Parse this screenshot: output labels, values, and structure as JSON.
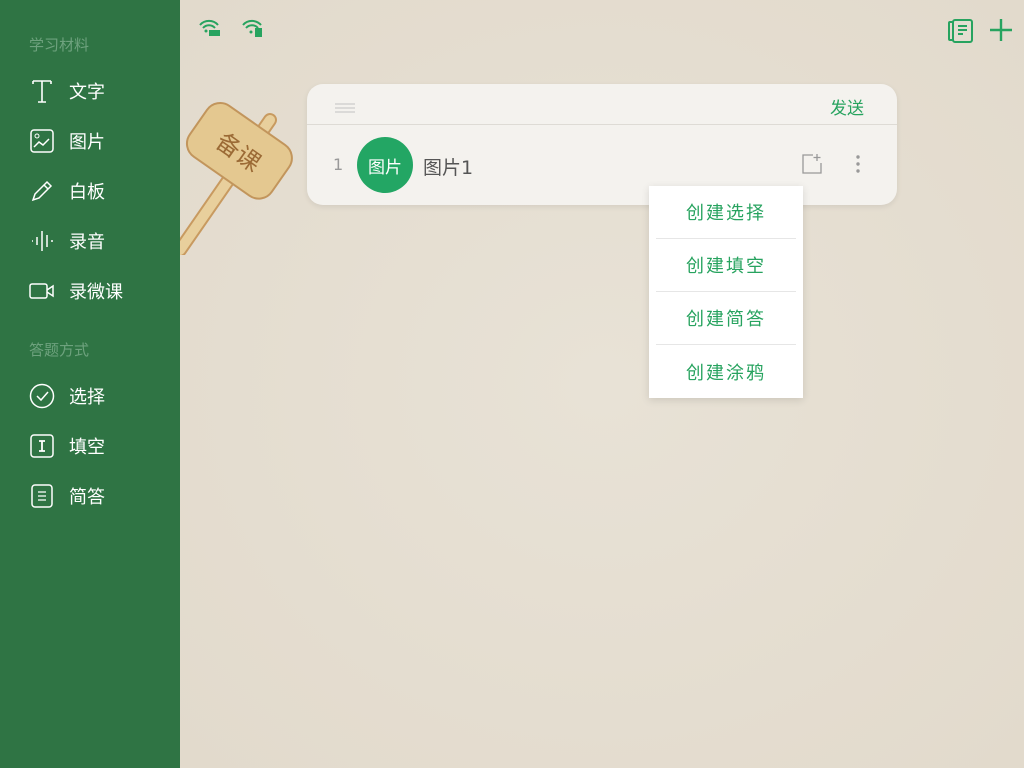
{
  "sidebar": {
    "section1": "学习材料",
    "materials": [
      {
        "label": "文字",
        "icon": "text-icon"
      },
      {
        "label": "图片",
        "icon": "image-icon"
      },
      {
        "label": "白板",
        "icon": "pencil-icon"
      },
      {
        "label": "录音",
        "icon": "audio-wave-icon"
      },
      {
        "label": "录微课",
        "icon": "video-camera-icon"
      }
    ],
    "section2": "答题方式",
    "answers": [
      {
        "label": "选择",
        "icon": "check-circle-icon"
      },
      {
        "label": "填空",
        "icon": "fill-blank-icon"
      },
      {
        "label": "简答",
        "icon": "list-icon"
      }
    ]
  },
  "sign": "备课",
  "card": {
    "send": "发送",
    "items": [
      {
        "index": "1",
        "badge": "图片",
        "title": "图片1"
      }
    ]
  },
  "menu": [
    "创建选择",
    "创建填空",
    "创建简答",
    "创建涂鸦"
  ],
  "colors": {
    "sidebar": "#2f7444",
    "accent": "#27a35f"
  }
}
